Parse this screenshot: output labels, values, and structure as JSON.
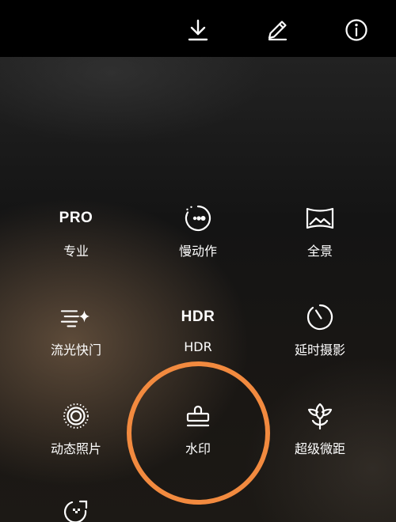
{
  "top_actions": [
    {
      "name": "download-icon"
    },
    {
      "name": "edit-icon"
    },
    {
      "name": "info-icon"
    }
  ],
  "modes": {
    "pro": {
      "icon_text": "PRO",
      "label": "专业"
    },
    "slow_motion": {
      "icon": "slow-motion-icon",
      "label": "慢动作"
    },
    "panorama": {
      "icon": "panorama-icon",
      "label": "全景"
    },
    "light_painting": {
      "icon": "light-painting-icon",
      "label": "流光快门"
    },
    "hdr": {
      "icon_text": "HDR",
      "label": "HDR"
    },
    "time_lapse": {
      "icon": "timer-icon",
      "label": "延时摄影"
    },
    "moving_picture": {
      "icon": "moving-picture-icon",
      "label": "动态照片"
    },
    "watermark": {
      "icon": "stamp-icon",
      "label": "水印"
    },
    "super_macro": {
      "icon": "flower-icon",
      "label": "超级微距"
    },
    "partial": {
      "icon": "scan-icon"
    }
  },
  "highlight_color": "#f28a3f"
}
